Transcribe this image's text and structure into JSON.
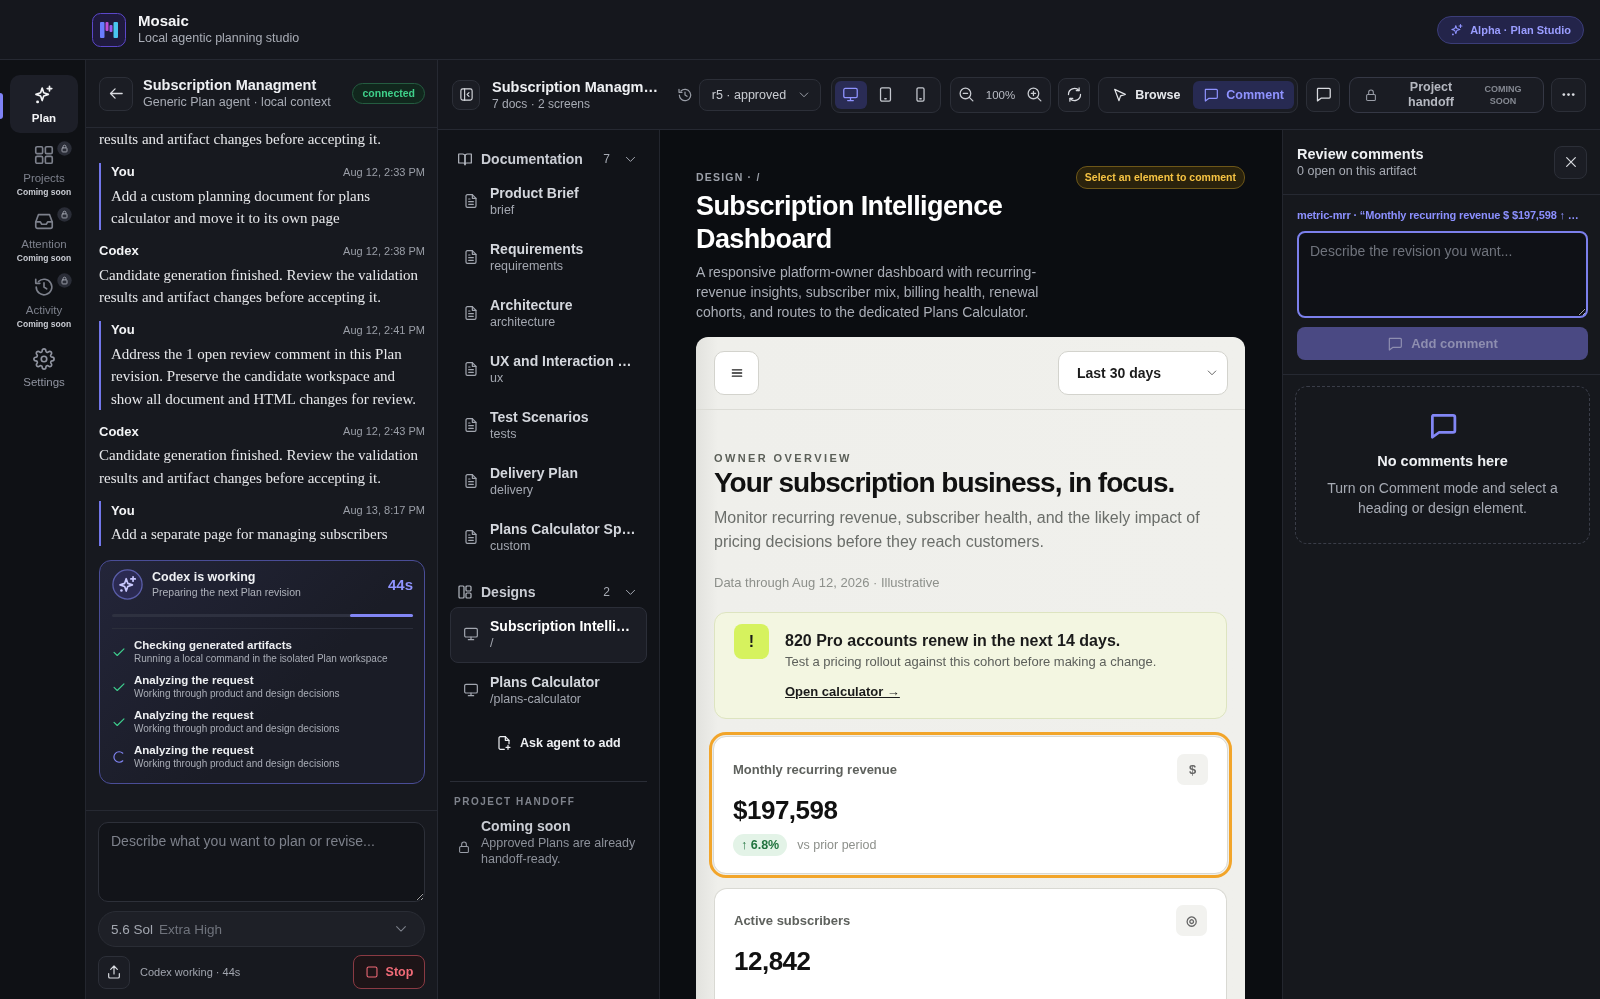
{
  "app": {
    "name": "Mosaic",
    "tagline": "Local agentic planning studio",
    "badge": "Alpha · Plan Studio"
  },
  "rail": {
    "items": [
      {
        "label": "Plan",
        "selected": true,
        "locked": false
      },
      {
        "label": "Projects",
        "note": "Coming soon",
        "selected": false,
        "locked": true
      },
      {
        "label": "Attention",
        "note": "Coming soon",
        "selected": false,
        "locked": true
      },
      {
        "label": "Activity",
        "note": "Coming soon",
        "selected": false,
        "locked": true
      },
      {
        "label": "Settings",
        "selected": false,
        "locked": false
      }
    ]
  },
  "chat": {
    "title": "Subscription Managment",
    "subtitle": "Generic Plan agent · local context",
    "status": "connected",
    "messages": [
      {
        "kind": "agent",
        "text": "results and artifact changes before accepting it."
      },
      {
        "kind": "user",
        "author": "You",
        "time": "Aug 12, 2:33 PM",
        "text": "Add a custom planning document for plans calculator and move it to its own page"
      },
      {
        "kind": "agent",
        "author": "Codex",
        "time": "Aug 12, 2:38 PM",
        "text": "Candidate generation finished. Review the validation results and artifact changes before accepting it."
      },
      {
        "kind": "user",
        "author": "You",
        "time": "Aug 12, 2:41 PM",
        "text": "Address the 1 open review comment in this Plan revision. Preserve the candidate workspace and show all document and HTML changes for review."
      },
      {
        "kind": "agent",
        "author": "Codex",
        "time": "Aug 12, 2:43 PM",
        "text": "Candidate generation finished. Review the validation results and artifact changes before accepting it."
      },
      {
        "kind": "user",
        "author": "You",
        "time": "Aug 13, 8:17 PM",
        "text": "Add a separate page for managing subscribers"
      }
    ],
    "progress": {
      "title": "Codex is working",
      "subtitle": "Preparing the next Plan revision",
      "elapsed": "44s",
      "level": 0.21,
      "steps": [
        {
          "title": "Checking generated artifacts",
          "detail": "Running a local command in the isolated Plan workspace",
          "done": true
        },
        {
          "title": "Analyzing the request",
          "detail": "Working through product and design decisions",
          "done": true
        },
        {
          "title": "Analyzing the request",
          "detail": "Working through product and design decisions",
          "done": true
        },
        {
          "title": "Analyzing the request",
          "detail": "Working through product and design decisions",
          "done": false
        }
      ]
    },
    "composer": {
      "placeholder": "Describe what you want to plan or revise...",
      "model": "5.6 Sol",
      "effort": "Extra High",
      "status": "Codex working · 44s",
      "stop": "Stop"
    }
  },
  "toolbar": {
    "title": "Subscription Managm…",
    "subtitle": "7 docs · 2 screens",
    "version": "r5 · approved",
    "devices": [
      {
        "selected": true
      },
      {
        "selected": false
      },
      {
        "selected": false
      }
    ],
    "zoom": "100%",
    "modes": [
      {
        "label": "Browse",
        "selected": false
      },
      {
        "label": "Comment",
        "selected": true
      }
    ],
    "handoff": {
      "label": "Project handoff",
      "note": "COMING SOON",
      "disabled": true
    }
  },
  "docs": {
    "sections": [
      {
        "kind": "docs",
        "title": "Documentation",
        "count": "7",
        "expanded": true,
        "items": [
          {
            "title": "Product Brief",
            "slug": "brief",
            "selected": false
          },
          {
            "title": "Requirements",
            "slug": "requirements",
            "selected": false
          },
          {
            "title": "Architecture",
            "slug": "architecture",
            "selected": false
          },
          {
            "title": "UX and Interaction …",
            "slug": "ux",
            "selected": false
          },
          {
            "title": "Test Scenarios",
            "slug": "tests",
            "selected": false
          },
          {
            "title": "Delivery Plan",
            "slug": "delivery",
            "selected": false
          },
          {
            "title": "Plans Calculator Sp…",
            "slug": "custom",
            "selected": false
          }
        ]
      },
      {
        "kind": "designs",
        "title": "Designs",
        "count": "2",
        "expanded": true,
        "items": [
          {
            "title": "Subscription Intelli…",
            "slug": "/",
            "selected": true
          },
          {
            "title": "Plans Calculator",
            "slug": "/plans-calculator",
            "selected": false
          }
        ],
        "add": "Ask agent to add"
      }
    ],
    "handoff": {
      "label": "PROJECT HANDOFF",
      "title": "Coming soon",
      "text": "Approved Plans are already handoff-ready."
    }
  },
  "preview": {
    "breadcrumb": "DESIGN · /",
    "hint": "Select an element to comment",
    "title": "Subscription Intelligence Dashboard",
    "description": "A responsive platform-owner dashboard with recurring-revenue insights, subscriber mix, billing health, renewal cohorts, and routes to the dedicated Plans Calculator.",
    "frame": {
      "range": "Last 30 days",
      "eyebrow": "OWNER OVERVIEW",
      "heading": "Your subscription business, in focus.",
      "lede": "Monitor recurring revenue, subscriber health, and the likely impact of pricing decisions before they reach customers.",
      "meta": "Data through Aug 12, 2026 · Illustrative",
      "alert": {
        "icon": "!",
        "title": "820 Pro accounts renew in the next 14 days.",
        "text": "Test a pricing rollout against this cohort before making a change.",
        "link": "Open calculator →"
      },
      "metrics": [
        {
          "label": "Monthly recurring revenue",
          "symbol": "$",
          "value": "$197,598",
          "delta": "↑ 6.8%",
          "delta_note": "vs prior period",
          "selected": true
        },
        {
          "label": "Active subscribers",
          "symbol": "◎",
          "value": "12,842",
          "selected": false
        }
      ]
    }
  },
  "review": {
    "title": "Review comments",
    "subtitle": "0 open on this artifact",
    "target": "metric-mrr · “Monthly recurring revenue $ $197,598 ↑ …",
    "placeholder": "Describe the revision you want...",
    "add": "Add comment",
    "add_disabled": true,
    "empty": {
      "title": "No comments here",
      "text": "Turn on Comment mode and select a heading or design element."
    }
  }
}
